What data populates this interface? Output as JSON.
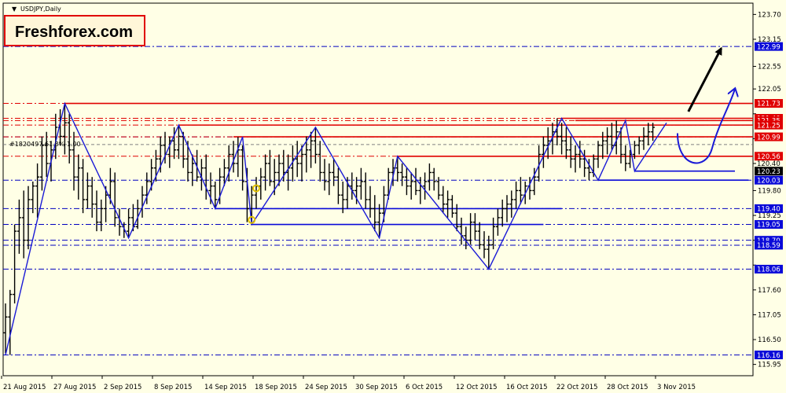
{
  "window": {
    "symbol_title": "USDJPY,Daily",
    "menu_arrow_icon": "triangle-down-icon",
    "brand_label": "Freshforex.com",
    "fib_label": "#1820497 61.8% 1.00",
    "colors": {
      "background": "#ffffe6",
      "bars": "#000000",
      "zigzag": "#1a1ad6",
      "support": "#0a0ad8",
      "resistance": "#e00000",
      "level_dash": "#0000c0",
      "brand_border": "#e00000",
      "brand_fill": "#fff6d8",
      "highlight_tag": "#000000",
      "fib_dash": "#808080"
    }
  },
  "chart_data": {
    "type": "ohlc",
    "title": "USDJPY,Daily",
    "ylim": [
      115.7,
      123.95
    ],
    "y_ticks": [
      "123.70",
      "123.15",
      "122.55",
      "122.05",
      "121.50",
      "120.95",
      "120.40",
      "119.80",
      "119.25",
      "118.70",
      "118.15",
      "117.60",
      "117.05",
      "116.50",
      "115.95"
    ],
    "x_labels": [
      "21 Aug 2015",
      "27 Aug 2015",
      "2 Sep 2015",
      "8 Sep 2015",
      "14 Sep 2015",
      "18 Sep 2015",
      "24 Sep 2015",
      "30 Sep 2015",
      "6 Oct 2015",
      "12 Oct 2015",
      "16 Oct 2015",
      "22 Oct 2015",
      "28 Oct 2015",
      "3 Nov 2015"
    ],
    "price_tags": [
      {
        "text": "122.99",
        "value": 122.99,
        "kind": "blue"
      },
      {
        "text": "121.73",
        "value": 121.73,
        "kind": "red"
      },
      {
        "text": "121.40",
        "value": 121.4,
        "kind": "red"
      },
      {
        "text": "121.35",
        "value": 121.35,
        "kind": "red"
      },
      {
        "text": "121.25",
        "value": 121.25,
        "kind": "red"
      },
      {
        "text": "120.99",
        "value": 120.99,
        "kind": "red"
      },
      {
        "text": "120.56",
        "value": 120.56,
        "kind": "red"
      },
      {
        "text": "120.40",
        "value": 120.4,
        "kind": "plain"
      },
      {
        "text": "120.23",
        "value": 120.23,
        "kind": "dark"
      },
      {
        "text": "120.03",
        "value": 120.03,
        "kind": "blue"
      },
      {
        "text": "119.40",
        "value": 119.4,
        "kind": "blue"
      },
      {
        "text": "119.05",
        "value": 119.05,
        "kind": "blue"
      },
      {
        "text": "118.70",
        "value": 118.7,
        "kind": "blue"
      },
      {
        "text": "118.59",
        "value": 118.59,
        "kind": "blue"
      },
      {
        "text": "118.06",
        "value": 118.06,
        "kind": "blue"
      },
      {
        "text": "116.16",
        "value": 116.16,
        "kind": "blue"
      }
    ],
    "dash_levels": [
      122.99,
      120.99,
      120.03,
      119.4,
      119.05,
      118.7,
      118.59,
      118.06,
      116.16
    ],
    "red_dash_levels": [
      121.73,
      121.4,
      121.35,
      121.25,
      120.99,
      120.56
    ],
    "resistance_segments": [
      {
        "value": 121.73,
        "from_bar": 13
      },
      {
        "value": 121.4,
        "from_bar": 122
      },
      {
        "value": 121.35,
        "from_bar": 125
      },
      {
        "value": 121.25,
        "from_bar": 38
      },
      {
        "value": 120.99,
        "from_bar": 50
      },
      {
        "value": 120.56,
        "from_bar": 86
      }
    ],
    "support_segments": [
      {
        "value": 120.23,
        "from_bar": 138,
        "to_bar": 160
      },
      {
        "value": 120.03,
        "from_bar": 130,
        "to_bar": 163
      },
      {
        "value": 119.4,
        "from_bar": 46,
        "to_bar": 122
      },
      {
        "value": 119.05,
        "from_bar": 54,
        "to_bar": 118
      }
    ],
    "zigzag": [
      {
        "bar": 0,
        "value": 116.16
      },
      {
        "bar": 13,
        "value": 121.73
      },
      {
        "bar": 27,
        "value": 118.75
      },
      {
        "bar": 38,
        "value": 121.25
      },
      {
        "bar": 46,
        "value": 119.4
      },
      {
        "bar": 52,
        "value": 120.99
      },
      {
        "bar": 54,
        "value": 119.05
      },
      {
        "bar": 68,
        "value": 121.2
      },
      {
        "bar": 82,
        "value": 118.75
      },
      {
        "bar": 86,
        "value": 120.56
      },
      {
        "bar": 106,
        "value": 118.06
      },
      {
        "bar": 122,
        "value": 121.4
      },
      {
        "bar": 130,
        "value": 120.03
      },
      {
        "bar": 136,
        "value": 121.35
      },
      {
        "bar": 138,
        "value": 120.23
      },
      {
        "bar": 145,
        "value": 121.3
      }
    ],
    "fib_level": 120.82,
    "forecast_arrows": [
      {
        "kind": "black",
        "start": [
          146,
          121.55
        ],
        "end": [
          157,
          122.95
        ]
      },
      {
        "kind": "blue-curve",
        "start": [
          145,
          121.0
        ],
        "end": [
          160,
          122.05
        ]
      }
    ],
    "ohlc": [
      [
        116.65,
        117.3,
        116.2,
        117.0
      ],
      [
        117.0,
        117.6,
        116.16,
        117.5
      ],
      [
        117.5,
        119.05,
        117.3,
        118.9
      ],
      [
        118.9,
        119.6,
        118.4,
        119.2
      ],
      [
        119.2,
        119.8,
        118.3,
        118.7
      ],
      [
        118.7,
        119.9,
        118.5,
        119.6
      ],
      [
        119.6,
        120.0,
        119.3,
        119.9
      ],
      [
        119.9,
        120.4,
        119.2,
        120.1
      ],
      [
        120.1,
        121.0,
        119.8,
        120.8
      ],
      [
        120.8,
        121.1,
        120.1,
        120.4
      ],
      [
        120.4,
        120.9,
        120.0,
        120.7
      ],
      [
        120.7,
        121.5,
        120.5,
        121.2
      ],
      [
        121.2,
        121.6,
        120.8,
        121.0
      ],
      [
        121.0,
        121.73,
        120.6,
        121.3
      ],
      [
        121.3,
        121.5,
        120.4,
        120.7
      ],
      [
        120.7,
        121.1,
        119.8,
        120.1
      ],
      [
        120.1,
        120.6,
        119.6,
        120.3
      ],
      [
        120.3,
        120.5,
        119.3,
        119.6
      ],
      [
        119.6,
        120.2,
        119.4,
        119.9
      ],
      [
        119.9,
        120.1,
        119.2,
        119.5
      ],
      [
        119.5,
        119.8,
        118.9,
        119.1
      ],
      [
        119.1,
        119.6,
        118.9,
        119.4
      ],
      [
        119.4,
        119.9,
        119.1,
        119.7
      ],
      [
        119.7,
        120.3,
        119.5,
        120.0
      ],
      [
        120.0,
        120.2,
        119.0,
        119.2
      ],
      [
        119.2,
        119.4,
        118.8,
        119.0
      ],
      [
        119.0,
        119.1,
        118.75,
        118.9
      ],
      [
        118.9,
        119.4,
        118.75,
        119.2
      ],
      [
        119.2,
        119.5,
        118.9,
        119.0
      ],
      [
        119.0,
        119.6,
        118.95,
        119.4
      ],
      [
        119.4,
        119.9,
        119.2,
        119.7
      ],
      [
        119.7,
        120.2,
        119.5,
        120.0
      ],
      [
        120.0,
        120.5,
        119.8,
        120.3
      ],
      [
        120.3,
        120.7,
        120.0,
        120.5
      ],
      [
        120.5,
        121.0,
        120.2,
        120.8
      ],
      [
        120.8,
        121.1,
        120.4,
        120.6
      ],
      [
        120.6,
        121.0,
        120.3,
        120.9
      ],
      [
        120.9,
        121.2,
        120.5,
        120.7
      ],
      [
        120.7,
        121.25,
        120.5,
        121.0
      ],
      [
        121.0,
        121.1,
        120.3,
        120.5
      ],
      [
        120.5,
        120.9,
        120.0,
        120.2
      ],
      [
        120.2,
        120.6,
        119.9,
        120.4
      ],
      [
        120.4,
        120.7,
        120.0,
        120.1
      ],
      [
        120.1,
        120.5,
        119.8,
        120.3
      ],
      [
        120.3,
        120.6,
        119.6,
        119.8
      ],
      [
        119.8,
        120.2,
        119.5,
        119.9
      ],
      [
        119.9,
        120.0,
        119.4,
        119.6
      ],
      [
        119.6,
        120.3,
        119.5,
        120.1
      ],
      [
        120.1,
        120.5,
        119.9,
        120.3
      ],
      [
        120.3,
        120.8,
        120.0,
        120.6
      ],
      [
        120.6,
        120.9,
        120.2,
        120.4
      ],
      [
        120.4,
        120.99,
        120.1,
        120.7
      ],
      [
        120.7,
        120.8,
        119.8,
        120.0
      ],
      [
        120.0,
        120.3,
        119.1,
        119.4
      ],
      [
        119.4,
        119.9,
        119.05,
        119.7
      ],
      [
        119.7,
        120.1,
        119.4,
        119.9
      ],
      [
        119.9,
        120.3,
        119.6,
        120.1
      ],
      [
        120.1,
        120.6,
        119.8,
        120.4
      ],
      [
        120.4,
        120.7,
        119.9,
        120.0
      ],
      [
        120.0,
        120.5,
        119.7,
        120.2
      ],
      [
        120.2,
        120.6,
        119.9,
        120.4
      ],
      [
        120.4,
        120.7,
        120.0,
        120.2
      ],
      [
        120.2,
        120.6,
        119.8,
        120.3
      ],
      [
        120.3,
        120.8,
        120.0,
        120.5
      ],
      [
        120.5,
        120.9,
        120.1,
        120.4
      ],
      [
        120.4,
        120.8,
        120.0,
        120.6
      ],
      [
        120.6,
        121.0,
        120.2,
        120.7
      ],
      [
        120.7,
        121.1,
        120.3,
        120.9
      ],
      [
        120.9,
        121.2,
        120.4,
        120.6
      ],
      [
        120.6,
        120.9,
        120.0,
        120.2
      ],
      [
        120.2,
        120.5,
        119.8,
        120.0
      ],
      [
        120.0,
        120.4,
        119.7,
        120.2
      ],
      [
        120.2,
        120.5,
        119.9,
        120.1
      ],
      [
        120.1,
        120.3,
        119.5,
        119.7
      ],
      [
        119.7,
        120.0,
        119.3,
        119.6
      ],
      [
        119.6,
        120.1,
        119.4,
        119.9
      ],
      [
        119.9,
        120.2,
        119.6,
        119.8
      ],
      [
        119.8,
        120.1,
        119.5,
        119.9
      ],
      [
        119.9,
        120.3,
        119.6,
        120.0
      ],
      [
        120.0,
        120.2,
        119.4,
        119.6
      ],
      [
        119.6,
        119.9,
        119.2,
        119.4
      ],
      [
        119.4,
        119.7,
        118.9,
        119.1
      ],
      [
        119.1,
        119.5,
        118.75,
        119.3
      ],
      [
        119.3,
        119.9,
        119.1,
        119.7
      ],
      [
        119.7,
        120.3,
        119.6,
        120.2
      ],
      [
        120.2,
        120.5,
        119.9,
        120.3
      ],
      [
        120.3,
        120.56,
        120.0,
        120.2
      ],
      [
        120.2,
        120.4,
        119.9,
        120.1
      ],
      [
        120.1,
        120.3,
        119.7,
        119.9
      ],
      [
        119.9,
        120.2,
        119.6,
        120.0
      ],
      [
        120.0,
        120.3,
        119.7,
        119.8
      ],
      [
        119.8,
        120.1,
        119.5,
        119.9
      ],
      [
        119.9,
        120.2,
        119.6,
        120.0
      ],
      [
        120.0,
        120.4,
        119.8,
        120.2
      ],
      [
        120.2,
        120.3,
        119.8,
        120.0
      ],
      [
        120.0,
        120.1,
        119.6,
        119.7
      ],
      [
        119.7,
        119.9,
        119.3,
        119.5
      ],
      [
        119.5,
        119.8,
        119.2,
        119.6
      ],
      [
        119.6,
        119.7,
        119.2,
        119.3
      ],
      [
        119.3,
        119.5,
        118.9,
        119.0
      ],
      [
        119.0,
        119.2,
        118.6,
        118.8
      ],
      [
        118.8,
        119.0,
        118.5,
        118.7
      ],
      [
        118.7,
        119.3,
        118.6,
        119.1
      ],
      [
        119.1,
        119.3,
        118.7,
        118.9
      ],
      [
        118.9,
        119.1,
        118.5,
        118.6
      ],
      [
        118.6,
        118.9,
        118.3,
        118.5
      ],
      [
        118.5,
        118.8,
        118.06,
        118.6
      ],
      [
        118.6,
        119.2,
        118.5,
        119.0
      ],
      [
        119.0,
        119.4,
        118.8,
        119.2
      ],
      [
        119.2,
        119.6,
        119.0,
        119.4
      ],
      [
        119.4,
        119.7,
        119.1,
        119.5
      ],
      [
        119.5,
        119.8,
        119.2,
        119.6
      ],
      [
        119.6,
        120.0,
        119.4,
        119.8
      ],
      [
        119.8,
        120.1,
        119.5,
        119.7
      ],
      [
        119.7,
        120.0,
        119.5,
        119.9
      ],
      [
        119.9,
        120.1,
        119.6,
        119.8
      ],
      [
        119.8,
        120.3,
        119.7,
        120.1
      ],
      [
        120.1,
        120.8,
        120.0,
        120.6
      ],
      [
        120.6,
        121.0,
        120.3,
        120.8
      ],
      [
        120.8,
        121.2,
        120.5,
        120.9
      ],
      [
        120.9,
        121.3,
        120.6,
        121.1
      ],
      [
        121.1,
        121.4,
        120.8,
        121.0
      ],
      [
        121.0,
        121.3,
        120.6,
        120.9
      ],
      [
        120.9,
        121.2,
        120.5,
        120.7
      ],
      [
        120.7,
        121.0,
        120.3,
        120.5
      ],
      [
        120.5,
        120.8,
        120.2,
        120.6
      ],
      [
        120.6,
        120.9,
        120.3,
        120.5
      ],
      [
        120.5,
        120.7,
        120.1,
        120.3
      ],
      [
        120.3,
        120.5,
        120.03,
        120.2
      ],
      [
        120.2,
        120.6,
        120.1,
        120.5
      ],
      [
        120.5,
        120.9,
        120.3,
        120.8
      ],
      [
        120.8,
        121.1,
        120.5,
        120.9
      ],
      [
        120.9,
        121.2,
        120.6,
        121.0
      ],
      [
        121.0,
        121.3,
        120.7,
        120.8
      ],
      [
        120.8,
        121.35,
        120.6,
        121.1
      ],
      [
        121.1,
        121.2,
        120.4,
        120.6
      ],
      [
        120.6,
        120.8,
        120.23,
        120.4
      ],
      [
        120.4,
        120.7,
        120.3,
        120.6
      ],
      [
        120.6,
        120.9,
        120.5,
        120.8
      ],
      [
        120.8,
        121.0,
        120.6,
        120.9
      ],
      [
        120.9,
        121.2,
        120.7,
        121.0
      ],
      [
        121.0,
        121.3,
        120.8,
        121.1
      ],
      [
        121.1,
        121.3,
        120.9,
        121.2
      ]
    ]
  }
}
